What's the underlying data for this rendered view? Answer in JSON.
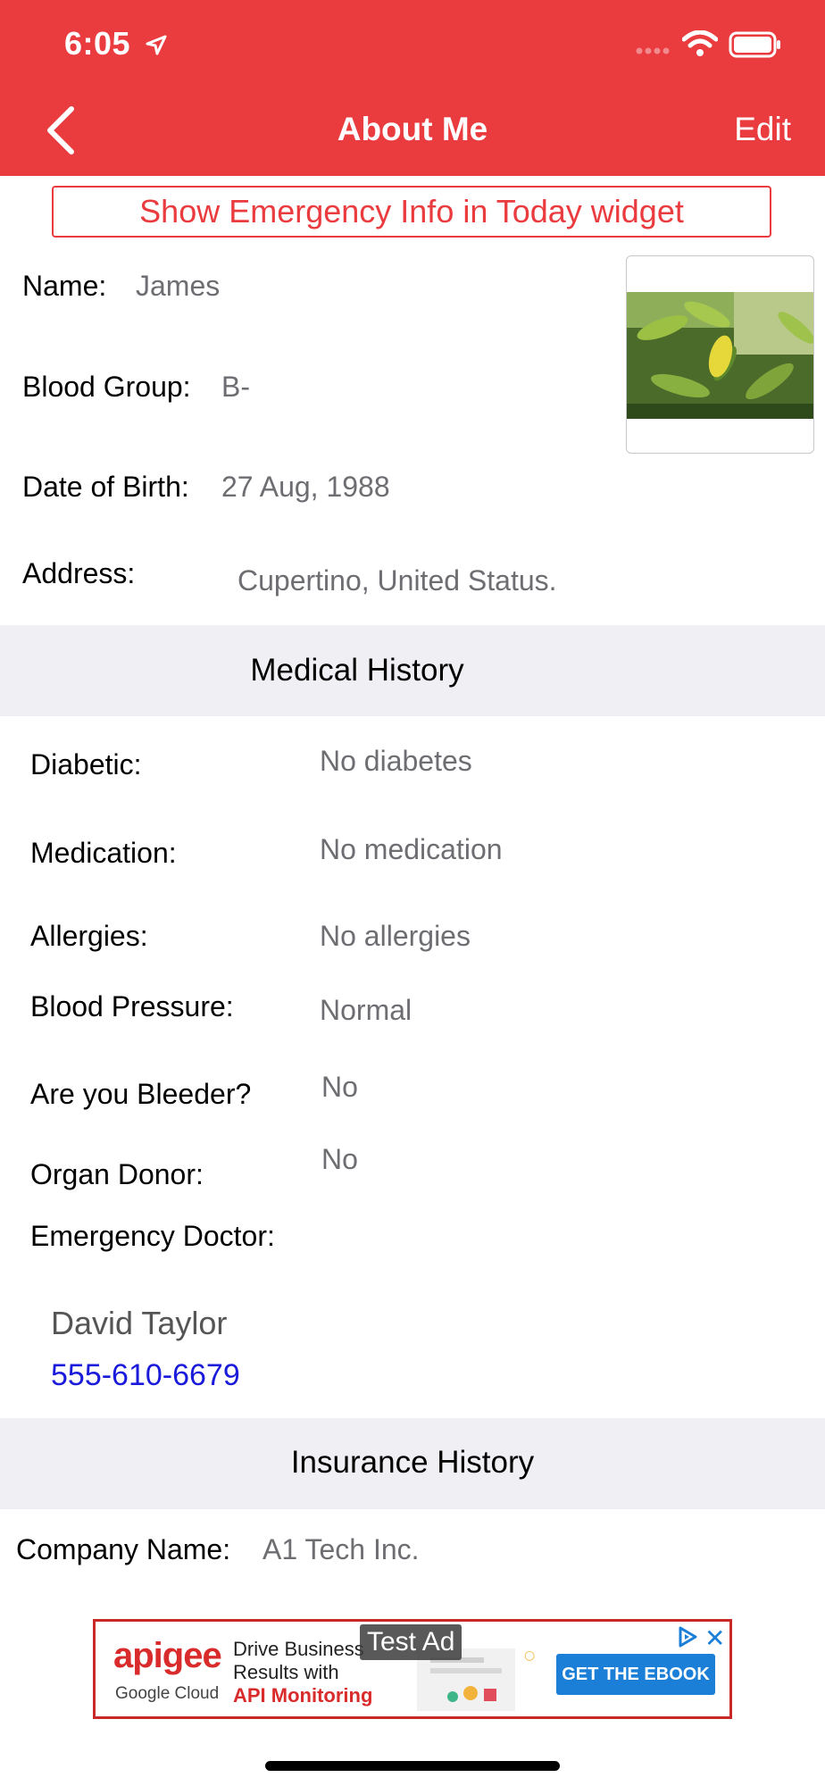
{
  "status_bar": {
    "time": "6:05"
  },
  "nav": {
    "title": "About Me",
    "edit_label": "Edit"
  },
  "emergency_button": {
    "label": "Show Emergency Info in Today widget"
  },
  "profile": {
    "name_label": "Name:",
    "name_value": "James",
    "blood_group_label": "Blood Group:",
    "blood_group_value": "B-",
    "dob_label": "Date of Birth:",
    "dob_value": "27 Aug, 1988",
    "address_label": "Address:",
    "address_value": "Cupertino, United Status."
  },
  "medical": {
    "title": "Medical History",
    "rows": [
      {
        "label": "Diabetic:",
        "value": "No diabetes"
      },
      {
        "label": "Medication:",
        "value": "No medication"
      },
      {
        "label": "Allergies:",
        "value": "No allergies"
      },
      {
        "label": "Blood Pressure:",
        "value": "Normal"
      },
      {
        "label": "Are you Bleeder?",
        "value": "No"
      },
      {
        "label": "Organ Donor:",
        "value": "No"
      }
    ],
    "doctor_label": "Emergency Doctor:",
    "doctor_name": "David Taylor",
    "doctor_phone": "555-610-6679"
  },
  "insurance": {
    "title": "Insurance History",
    "company_label": "Company Name:",
    "company_value": "A1 Tech Inc."
  },
  "ad": {
    "label": "Test Ad",
    "brand": "apigee",
    "brand_sub": "Google Cloud",
    "copy_line1": "Drive Business",
    "copy_line2": "Results with",
    "copy_line3": "API Monitoring",
    "cta": "GET THE EBOOK"
  },
  "colors": {
    "accent": "#ea3b3f",
    "section_bg": "#efeff4",
    "link": "#1a1adb"
  }
}
